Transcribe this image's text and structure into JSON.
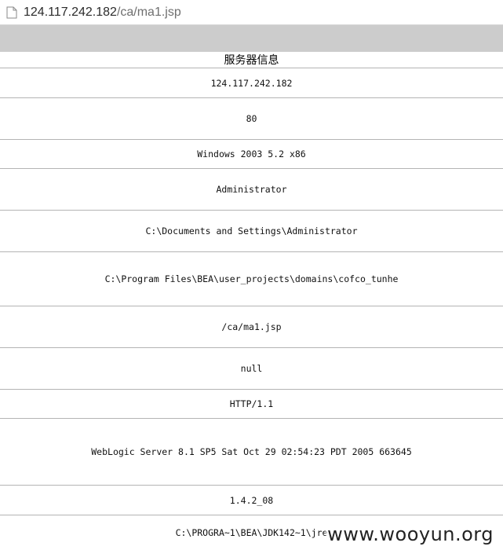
{
  "browser": {
    "url_host": "124.117.242.182",
    "url_path": "/ca/ma1.jsp"
  },
  "page": {
    "title": "服务器信息",
    "rows": [
      "124.117.242.182",
      "80",
      "Windows 2003 5.2 x86",
      "Administrator",
      "C:\\Documents and Settings\\Administrator",
      "C:\\Program Files\\BEA\\user_projects\\domains\\cofco_tunhe",
      "/ca/ma1.jsp",
      "null",
      "HTTP/1.1",
      "WebLogic Server 8.1 SP5 Sat Oct 29 02:54:23 PDT 2005 663645",
      "1.4.2_08",
      "C:\\PROGRA~1\\BEA\\JDK142~1\\jre"
    ]
  },
  "watermark": "www.wooyun.org"
}
